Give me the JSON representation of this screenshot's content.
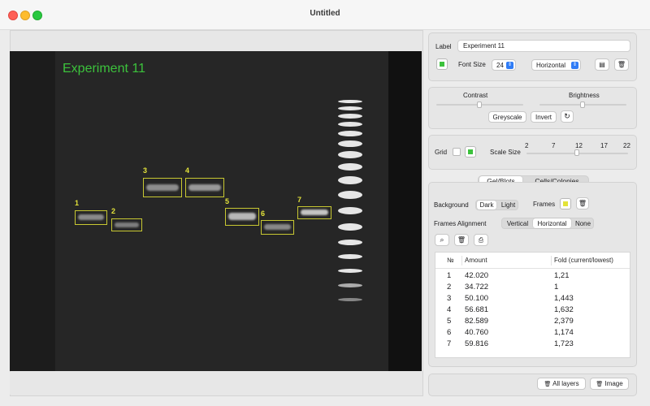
{
  "window": {
    "title": "Untitled"
  },
  "gel": {
    "title": "Experiment 11",
    "bands": [
      {
        "num": "1"
      },
      {
        "num": "2"
      },
      {
        "num": "3"
      },
      {
        "num": "4"
      },
      {
        "num": "5"
      },
      {
        "num": "6"
      },
      {
        "num": "7"
      }
    ]
  },
  "label_panel": {
    "label_caption": "Label",
    "label_value": "Experiment 11",
    "font_size_caption": "Font Size",
    "font_size_value": "24",
    "orientation_value": "Horizontal",
    "label_color": "#3cc23c"
  },
  "adjust_panel": {
    "contrast_caption": "Contrast",
    "brightness_caption": "Brightness",
    "contrast_level": 0.5,
    "brightness_level": 0.5,
    "greyscale_label": "Greyscale",
    "invert_label": "Invert"
  },
  "grid_panel": {
    "grid_caption": "Grid",
    "scale_caption": "Scale Size",
    "scale_ticks": [
      "2",
      "7",
      "12",
      "17",
      "22"
    ],
    "scale_value": 12,
    "grid_color": "#3cc23c"
  },
  "tabs": [
    {
      "label": "Gel/Blots",
      "selected": true
    },
    {
      "label": "Cells/Colonies",
      "selected": false
    }
  ],
  "analysis": {
    "background_caption": "Background",
    "background_options": [
      "Dark",
      "Light"
    ],
    "background_selected": "Dark",
    "frames_caption": "Frames",
    "frames_color": "#e3e33a",
    "alignment_caption": "Frames Alignment",
    "alignment_options": [
      "Vertical",
      "Horizontal",
      "None"
    ],
    "alignment_selected": "Horizontal"
  },
  "table": {
    "headers": [
      "№",
      "Amount",
      "Fold (current/lowest)"
    ],
    "rows": [
      [
        "1",
        "42.020",
        "1,21"
      ],
      [
        "2",
        "34.722",
        "1"
      ],
      [
        "3",
        "50.100",
        "1,443"
      ],
      [
        "4",
        "56.681",
        "1,632"
      ],
      [
        "5",
        "82.589",
        "2,379"
      ],
      [
        "6",
        "40.760",
        "1,174"
      ],
      [
        "7",
        "59.816",
        "1,723"
      ]
    ]
  },
  "bottom": {
    "all_layers_label": "All layers",
    "image_label": "Image"
  }
}
